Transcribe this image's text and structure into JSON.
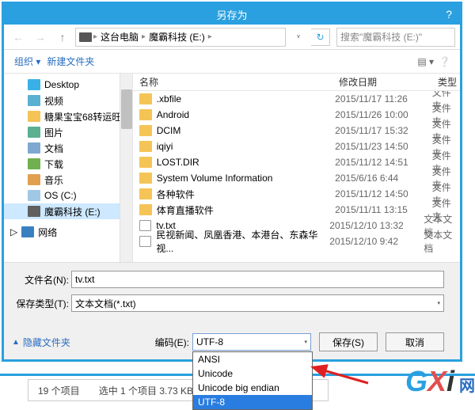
{
  "title": "另存为",
  "nav": {
    "pc": "这台电脑",
    "drive": "魔霸科技 (E:)",
    "search_placeholder": "搜索\"魔霸科技 (E:)\""
  },
  "toolbar": {
    "organize": "组织 ▾",
    "newfolder": "新建文件夹"
  },
  "sidebar": {
    "items": [
      {
        "label": "Desktop",
        "icon": "desktop"
      },
      {
        "label": "视频",
        "icon": "video"
      },
      {
        "label": "糖果宝宝68转运旺",
        "icon": "folder"
      },
      {
        "label": "图片",
        "icon": "picture"
      },
      {
        "label": "文档",
        "icon": "doc"
      },
      {
        "label": "下载",
        "icon": "download"
      },
      {
        "label": "音乐",
        "icon": "music"
      },
      {
        "label": "OS (C:)",
        "icon": "drive"
      },
      {
        "label": "魔霸科技 (E:)",
        "icon": "drive2"
      }
    ],
    "network": "网络"
  },
  "columns": {
    "name": "名称",
    "date": "修改日期",
    "type": "类型"
  },
  "files": [
    {
      "name": ".xbfile",
      "date": "2015/11/17 11:26",
      "type": "文件夹",
      "icon": "folder"
    },
    {
      "name": "Android",
      "date": "2015/11/26 10:00",
      "type": "文件夹",
      "icon": "folder"
    },
    {
      "name": "DCIM",
      "date": "2015/11/17 15:32",
      "type": "文件夹",
      "icon": "folder"
    },
    {
      "name": "iqiyi",
      "date": "2015/11/23 14:50",
      "type": "文件夹",
      "icon": "folder"
    },
    {
      "name": "LOST.DIR",
      "date": "2015/11/12 14:51",
      "type": "文件夹",
      "icon": "folder"
    },
    {
      "name": "System Volume Information",
      "date": "2015/6/16 6:44",
      "type": "文件夹",
      "icon": "folder"
    },
    {
      "name": "各种软件",
      "date": "2015/11/12 14:50",
      "type": "文件夹",
      "icon": "folder"
    },
    {
      "name": "体育直播软件",
      "date": "2015/11/11 13:15",
      "type": "文件夹",
      "icon": "folder"
    },
    {
      "name": "tv.txt",
      "date": "2015/12/10 13:32",
      "type": "文本文档",
      "icon": "txt"
    },
    {
      "name": "民视新闻、凤凰香港、本港台、东森华视...",
      "date": "2015/12/10 9:42",
      "type": "文本文档",
      "icon": "txt"
    }
  ],
  "form": {
    "filename_label": "文件名(N):",
    "filename_value": "tv.txt",
    "filetype_label": "保存类型(T):",
    "filetype_value": "文本文档(*.txt)"
  },
  "actions": {
    "hide_folders": "隐藏文件夹",
    "encoding_label": "编码(E):",
    "encoding_value": "UTF-8",
    "save": "保存(S)",
    "cancel": "取消"
  },
  "encoding_options": [
    "ANSI",
    "Unicode",
    "Unicode big endian",
    "UTF-8"
  ],
  "status": {
    "count": "19 个项目",
    "selected": "选中 1 个项目  3.73 KB"
  },
  "watermark": {
    "g": "G",
    "x": "X",
    "i": "i",
    "cn": "网"
  }
}
